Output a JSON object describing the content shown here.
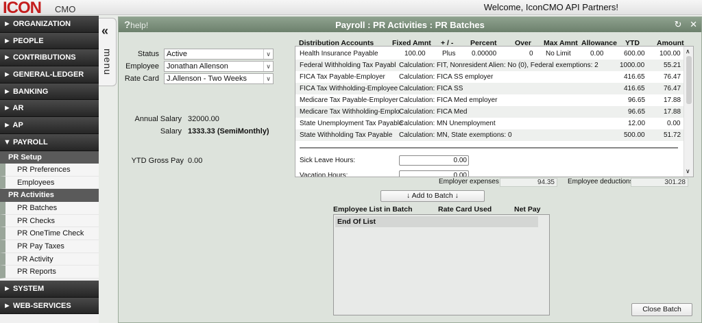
{
  "app": {
    "logo_text": "ICON",
    "logo_sub": "CMO",
    "welcome": "Welcome, IconCMO API Partners!"
  },
  "sidebar": {
    "sections_top": [
      {
        "label": "► ORGANIZATION"
      },
      {
        "label": "► PEOPLE"
      },
      {
        "label": "► CONTRIBUTIONS"
      },
      {
        "label": "► GENERAL-LEDGER"
      },
      {
        "label": "► BANKING"
      },
      {
        "label": "► AR"
      },
      {
        "label": "► AP"
      },
      {
        "label": "▼ PAYROLL"
      }
    ],
    "pr_setup": {
      "label": "PR Setup",
      "items": [
        "PR Preferences",
        "Employees"
      ]
    },
    "pr_activities": {
      "label": "PR Activities",
      "items": [
        "PR Batches",
        "PR Checks",
        "PR OneTime Check",
        "PR Pay Taxes",
        "PR Activity",
        "PR Reports"
      ]
    },
    "sections_bottom": [
      {
        "label": "► SYSTEM"
      },
      {
        "label": "► WEB-SERVICES"
      }
    ]
  },
  "menu_tab": {
    "chevron": "«",
    "label": "menu"
  },
  "panel": {
    "help_q": "?",
    "help": "help!",
    "title": "Payroll : PR Activities : PR Batches",
    "icons": [
      "refresh-icon",
      "close-icon"
    ]
  },
  "form": {
    "status_label": "Status",
    "status_value": "Active",
    "employee_label": "Employee",
    "employee_value": "Jonathan Allenson",
    "ratecard_label": "Rate Card",
    "ratecard_value": "J.Allenson - Two Weeks",
    "annual_salary_label": "Annual Salary",
    "annual_salary_value": "32000.00",
    "salary_label": "Salary",
    "salary_value": "1333.33 (SemiMonthly)",
    "ytd_label": "YTD Gross Pay",
    "ytd_value": "0.00"
  },
  "dist": {
    "headers": [
      "Distribution Accounts",
      "Fixed Amnt",
      "+ / -",
      "Percent",
      "Over",
      "Max Amnt",
      "Allowance",
      "YTD",
      "Amount"
    ],
    "rows": [
      {
        "account": "Health Insurance Payable",
        "fixed": "100.00",
        "pm": "Plus",
        "percent": "0.00000",
        "over": "0",
        "max": "No Limit",
        "allowance": "0.00",
        "ytd": "600.00",
        "amount": "100.00"
      },
      {
        "account": "Federal Withholding Tax Payabl",
        "calc": "Calculation: FIT, Nonresident Alien: No (0), Federal exemptions: 2",
        "ytd": "1000.00",
        "amount": "55.21"
      },
      {
        "account": "FICA Tax Payable-Employer",
        "calc": "Calculation: FICA SS employer",
        "ytd": "416.65",
        "amount": "76.47"
      },
      {
        "account": "FICA Tax Withholding-Employee",
        "calc": "Calculation: FICA SS",
        "ytd": "416.65",
        "amount": "76.47"
      },
      {
        "account": "Medicare Tax Payable-Employer",
        "calc": "Calculation: FICA Med employer",
        "ytd": "96.65",
        "amount": "17.88"
      },
      {
        "account": "Medicare Tax Withholding-Emplo",
        "calc": "Calculation: FICA Med",
        "ytd": "96.65",
        "amount": "17.88"
      },
      {
        "account": "State Unemployment Tax Payable",
        "calc": "Calculation: MN Unemployment",
        "ytd": "12.00",
        "amount": "0.00"
      },
      {
        "account": "State Withholding Tax Payable",
        "calc": "Calculation: MN, State exemptions: 0",
        "ytd": "500.00",
        "amount": "51.72"
      }
    ],
    "sick_label": "Sick Leave Hours:",
    "sick_value": "0.00",
    "vacation_label": "Vacation Hours:",
    "vacation_value": "0.00"
  },
  "totals": {
    "employer_label": "Employer expenses",
    "employer_value": "94.35",
    "deductions_label": "Employee deductions",
    "deductions_value": "301.28"
  },
  "buttons": {
    "add_to_batch": "↓ Add to Batch ↓",
    "close_batch": "Close Batch"
  },
  "batch_list": {
    "headers": [
      "Employee List in Batch",
      "Rate Card Used",
      "Net Pay"
    ],
    "end_label": "End Of List"
  }
}
